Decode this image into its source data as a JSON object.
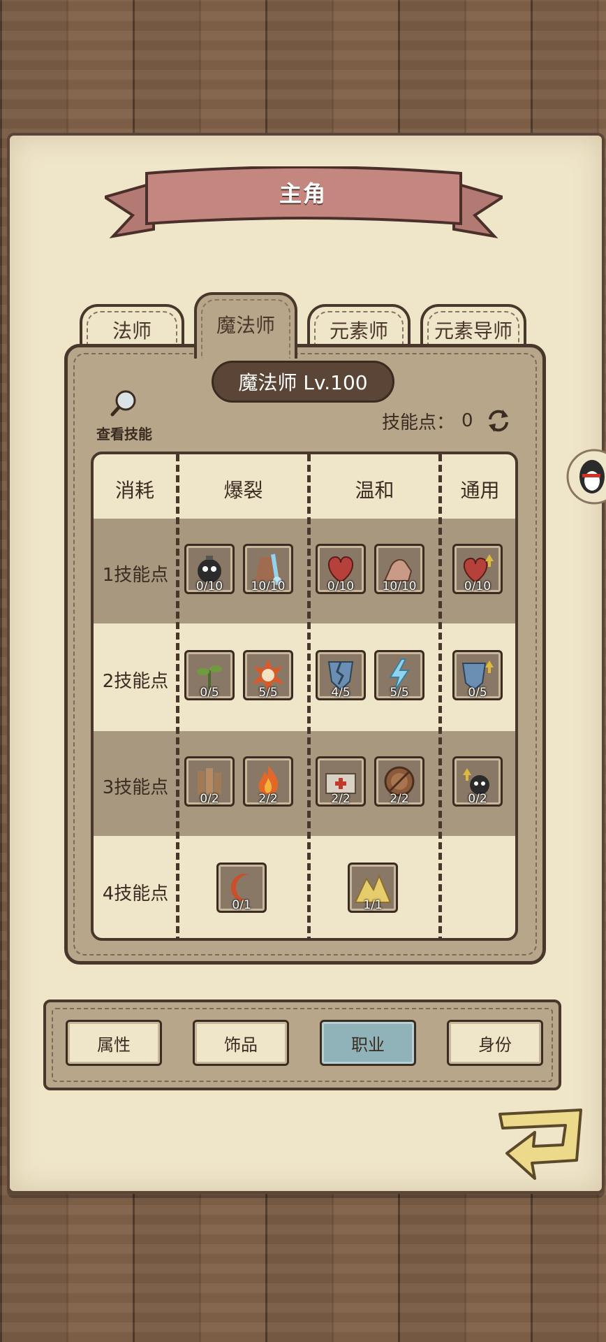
{
  "header": {
    "title": "主角"
  },
  "class_tabs": [
    "法师",
    "魔法师",
    "元素师",
    "元素导师"
  ],
  "active_class_tab": 1,
  "panel": {
    "level_label": "魔法师 Lv.100",
    "view_skills_label": "查看技能",
    "skill_points_label": "技能点：",
    "skill_points_value": "0"
  },
  "grid": {
    "headers": [
      "消耗",
      "爆裂",
      "温和",
      "通用"
    ],
    "row_labels": [
      "1技能点",
      "2技能点",
      "3技能点",
      "4技能点"
    ],
    "skills": {
      "r1": [
        {
          "icon": "skull-bomb-icon",
          "count": "0/10"
        },
        {
          "icon": "magic-staff-icon",
          "count": "10/10"
        },
        {
          "icon": "heart-icon",
          "count": "0/10"
        },
        {
          "icon": "flexed-arm-icon",
          "count": "10/10"
        },
        {
          "icon": "heart-upgrade-icon",
          "count": "0/10"
        }
      ],
      "r2": [
        {
          "icon": "sprout-icon",
          "count": "0/5"
        },
        {
          "icon": "explosion-skull-icon",
          "count": "5/5"
        },
        {
          "icon": "broken-shield-icon",
          "count": "4/5"
        },
        {
          "icon": "lightning-icon",
          "count": "5/5"
        },
        {
          "icon": "shield-upgrade-icon",
          "count": "0/5"
        }
      ],
      "r3": [
        {
          "icon": "wooden-stakes-icon",
          "count": "0/2"
        },
        {
          "icon": "fire-icon",
          "count": "2/2"
        },
        {
          "icon": "first-aid-box-icon",
          "count": "2/2"
        },
        {
          "icon": "round-shield-icon",
          "count": "2/2"
        },
        {
          "icon": "skull-upgrade-icon",
          "count": "0/2"
        }
      ],
      "r4": [
        {
          "icon": "crescent-moon-icon",
          "count": "0/1"
        },
        {
          "icon": "golden-mountain-icon",
          "count": "1/1"
        }
      ]
    }
  },
  "bottom_tabs": [
    "属性",
    "饰品",
    "职业",
    "身份"
  ],
  "active_bottom_tab": 2
}
